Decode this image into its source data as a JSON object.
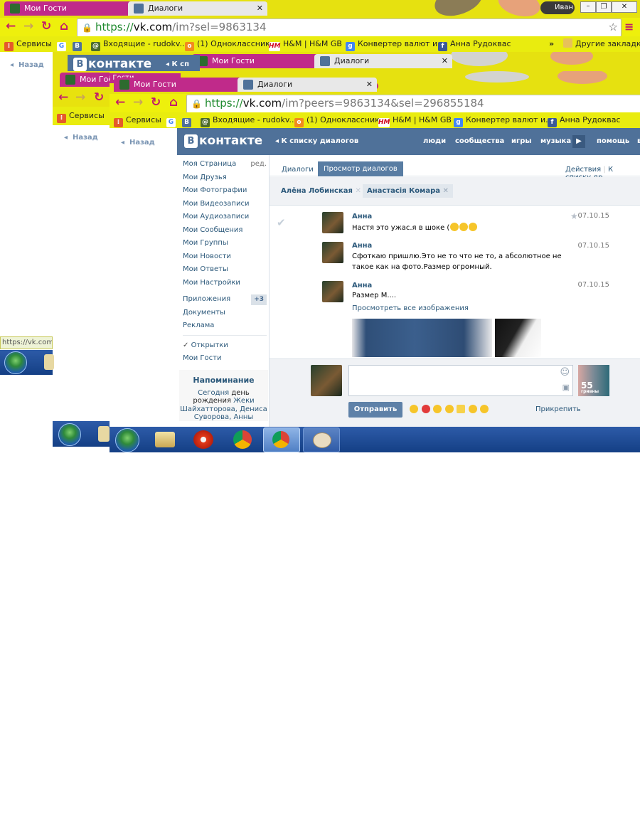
{
  "colors": {
    "chrome_yellow": "#e6e110",
    "tab_active": "#c02a8a",
    "vk_blue": "#4f7199",
    "link": "#2b587a",
    "taskbar": "#1f4a93"
  },
  "win1": {
    "tabs": [
      {
        "label": "Мои Гости",
        "icon": "guests-favicon"
      },
      {
        "label": "Диалоги",
        "icon": "vk-dialogs-favicon"
      }
    ],
    "user": "Иван",
    "url": {
      "scheme": "https://",
      "host": "vk.com",
      "path": "/im?sel=9863134"
    },
    "bookmarks": [
      "Сервисы",
      "Входящие - rudokv...",
      "(1) Одноклассники",
      "H&M | H&M GB",
      "Конвертер валют и...",
      "Анна Рудоквас"
    ],
    "other_bookmarks": "Другие закладки",
    "back": "Назад",
    "status_url": "https://vk.com/"
  },
  "win2": {
    "tabs": [
      {
        "label": "Мои Гости"
      },
      {
        "label": "Диалоги"
      }
    ],
    "vk_back_fragment": "К сп",
    "bookmarks": [
      "Сервисы"
    ],
    "back": "Назад"
  },
  "win3": {
    "tabs": [
      {
        "label": "Мои Гости"
      },
      {
        "label": "Диалоги"
      }
    ],
    "tabs_behind": [
      {
        "label": "Мои Гости"
      },
      {
        "label": "Диалоги"
      }
    ],
    "url": {
      "scheme": "https://",
      "host": "vk.com",
      "path": "/im?peers=9863134&sel=296855184"
    },
    "bookmarks": [
      "Сервисы",
      "Входящие - rudokv...",
      "(1) Одноклассники",
      "H&M | H&M GB",
      "Конвертер валют и...",
      "Анна Рудоквас"
    ],
    "back": "Назад"
  },
  "vk": {
    "logo": "контакте",
    "logo_letter": "В",
    "back_to_list": "К списку диалогов",
    "nav": [
      "люди",
      "сообщества",
      "игры",
      "музыка",
      "помощь",
      "в"
    ],
    "menu": [
      "Моя Страница",
      "Мои Друзья",
      "Мои Фотографии",
      "Мои Видеозаписи",
      "Мои Аудиозаписи",
      "Мои Сообщения",
      "Мои Группы",
      "Мои Новости",
      "Мои Ответы",
      "Мои Настройки"
    ],
    "menu_edit": "ред.",
    "menu2": [
      "Приложения",
      "Документы",
      "Реклама"
    ],
    "apps_badge": "+3",
    "menu3": [
      "Открытки",
      "Мои Гости"
    ],
    "check": "✓",
    "reminder_title": "Напоминание",
    "reminder_text_1": "Сегодня",
    "reminder_text_2": "день",
    "reminder_text_3": "рождения",
    "reminder_names": [
      "Жеки Шайхатторова,",
      "Дениса Суворова,",
      "Анны Абанкиной"
    ],
    "tabs": {
      "dialogs": "Диалоги",
      "view": "Просмотр диалогов"
    },
    "actions": "Действия",
    "to_list": "К списку др",
    "peers": [
      "Алёна Лобинская",
      "Анастасія Комара"
    ],
    "messages": [
      {
        "name": "Анна",
        "text": "Настя это ужас.я в шоке (",
        "date": "07.10.15"
      },
      {
        "name": "Анна",
        "text": "Сфоткаю пришлю.Это не то что не то, а абсолютное не такое как на фото.Размер огромный.",
        "date": "07.10.15"
      },
      {
        "name": "Анна",
        "text": "Размер М....",
        "date": "07.10.15",
        "link": "Просмотреть все изображения"
      }
    ],
    "send": "Отправить",
    "attach": "Прикрепить",
    "peer_avatar_label": "55",
    "peer_avatar_sub": "гривны"
  }
}
